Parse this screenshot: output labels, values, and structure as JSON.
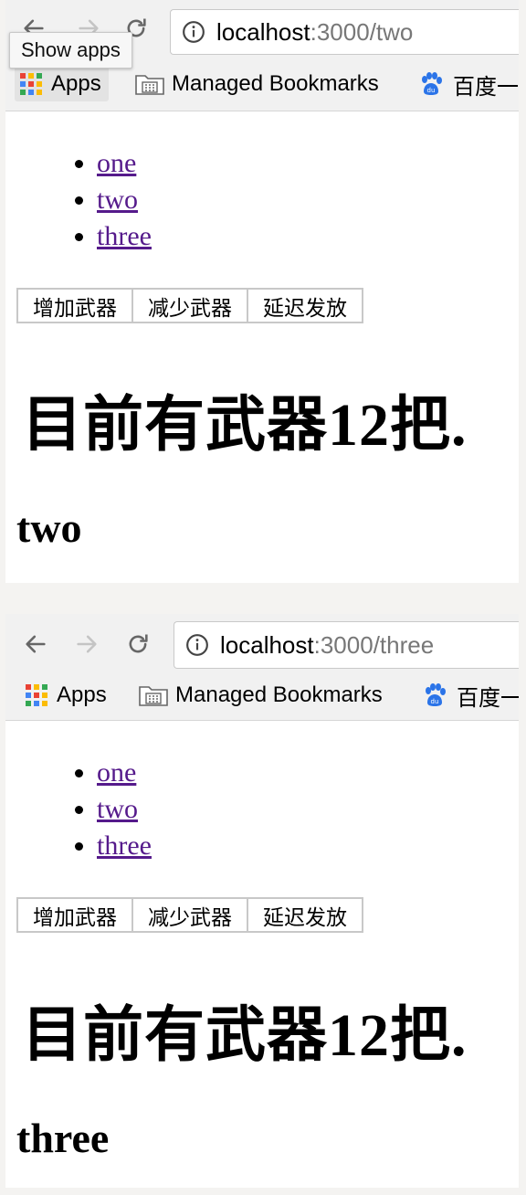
{
  "screenshots": [
    {
      "url": {
        "host": "localhost",
        "rest": ":3000/two"
      },
      "tooltip": "Show apps",
      "bookmarks": {
        "apps": "Apps",
        "managed": "Managed Bookmarks",
        "baidu": "百度一"
      },
      "nav_links": [
        "one",
        "two",
        "three"
      ],
      "buttons": {
        "add": "增加武器",
        "reduce": "减少武器",
        "delay": "延迟发放"
      },
      "count_text": "目前有武器12把.",
      "route_title": "two"
    },
    {
      "url": {
        "host": "localhost",
        "rest": ":3000/three"
      },
      "bookmarks": {
        "apps": "Apps",
        "managed": "Managed Bookmarks",
        "baidu": "百度一"
      },
      "nav_links": [
        "one",
        "two",
        "three"
      ],
      "buttons": {
        "add": "增加武器",
        "reduce": "减少武器",
        "delay": "延迟发放"
      },
      "count_text": "目前有武器12把.",
      "route_title": "three"
    }
  ],
  "colors": {
    "link_visited": "#551a8b",
    "apps_grid": [
      "#e94235",
      "#fbbc05",
      "#34a853",
      "#4285f4",
      "#e94235",
      "#fbbc05",
      "#34a853",
      "#4285f4",
      "#fbbc05"
    ],
    "baidu_blue": "#2b74e8"
  },
  "icons": {
    "back": "arrow-left-icon",
    "forward": "arrow-right-icon",
    "reload": "reload-icon",
    "info": "info-circle-icon",
    "apps": "apps-grid-icon",
    "folder": "folder-icon",
    "baidu": "baidu-paw-icon"
  }
}
